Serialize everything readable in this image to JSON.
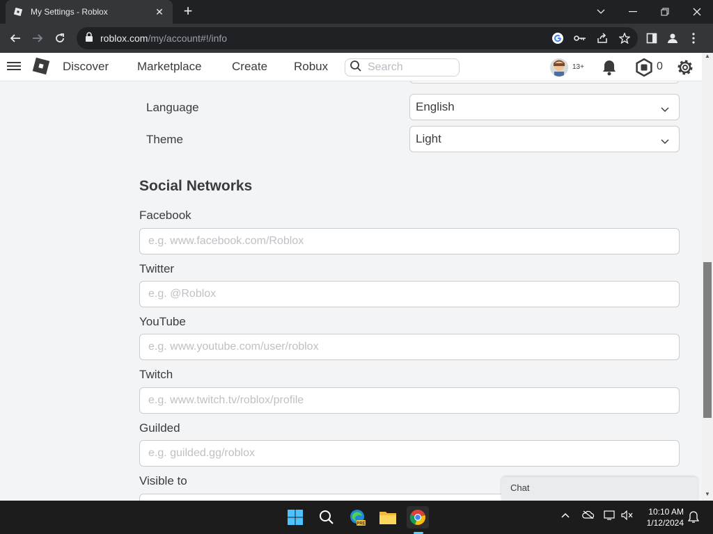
{
  "browser": {
    "tab_title": "My Settings - Roblox",
    "url_domain": "roblox.com",
    "url_path": "/my/account#!/info",
    "icons": [
      "roblox-favicon",
      "close-icon",
      "plus-icon",
      "chevron-down-icon",
      "minimize-icon",
      "restore-icon",
      "close-window-icon",
      "back-icon",
      "forward-icon",
      "reload-icon",
      "lock-icon",
      "google-icon",
      "key-icon",
      "share-icon",
      "star-icon",
      "sidebar-icon",
      "profile-icon",
      "kebab-menu-icon"
    ]
  },
  "header": {
    "nav": [
      "Discover",
      "Marketplace",
      "Create",
      "Robux"
    ],
    "search_placeholder": "Search",
    "age_badge": "13+",
    "robux_balance": "0"
  },
  "settings": {
    "language_label": "Language",
    "language_value": "English",
    "theme_label": "Theme",
    "theme_value": "Light"
  },
  "social": {
    "title": "Social Networks",
    "fields": [
      {
        "label": "Facebook",
        "placeholder": "e.g. www.facebook.com/Roblox"
      },
      {
        "label": "Twitter",
        "placeholder": "e.g. @Roblox"
      },
      {
        "label": "YouTube",
        "placeholder": "e.g. www.youtube.com/user/roblox"
      },
      {
        "label": "Twitch",
        "placeholder": "e.g. www.twitch.tv/roblox/profile"
      },
      {
        "label": "Guilded",
        "placeholder": "e.g. guilded.gg/roblox"
      }
    ],
    "visible_to_label": "Visible to"
  },
  "chat": {
    "label": "Chat"
  },
  "taskbar": {
    "time": "10:10 AM",
    "date": "1/12/2024"
  },
  "colors": {
    "accent_blue": "#60cdff",
    "roblox_text": "#393b3d",
    "page_bg": "#f2f4f5"
  }
}
